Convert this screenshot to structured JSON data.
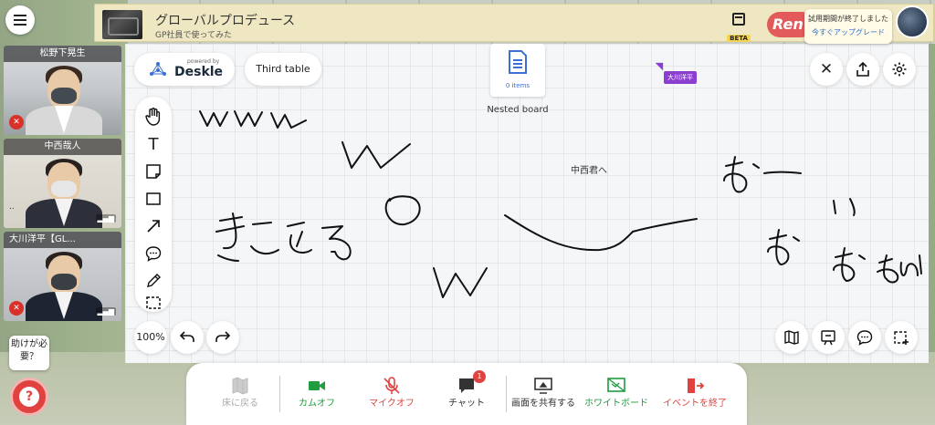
{
  "header": {
    "space_title": "グローバルプロデュース",
    "space_subtitle": "GP社員で使ってみた",
    "beta_label": "BETA",
    "brand": "Ren",
    "trial_notice": "試用期間が終了しました",
    "upgrade_link": "今すぐアップグレード"
  },
  "participants": [
    {
      "name": "松野下晃生",
      "mic": "off"
    },
    {
      "name": "中西哉人",
      "mic": "on"
    },
    {
      "name": "大川洋平【GL...",
      "mic": "off"
    }
  ],
  "help": {
    "bubble_text": "助けが必要？"
  },
  "board": {
    "powered_by": "powered by",
    "logo_name": "Deskle",
    "board_title": "Third table",
    "nested_items": "0 items",
    "nested_label": "Nested board",
    "cursor_user": "大川洋平",
    "text_note": "中西君へ",
    "zoom": "100%"
  },
  "bottom_bar": {
    "back_to_floor": "床に戻る",
    "cam_off": "カムオフ",
    "mic_off": "マイクオフ",
    "chat": "チャット",
    "chat_badge": "1",
    "share_screen": "画面を共有する",
    "whiteboard": "ホワイトボード",
    "end_event": "イベントを終了"
  },
  "colors": {
    "accent_green": "#1f9d3f",
    "accent_red": "#e0423f",
    "cursor_purple": "#8a3fd1",
    "link_blue": "#2c6fd1"
  }
}
